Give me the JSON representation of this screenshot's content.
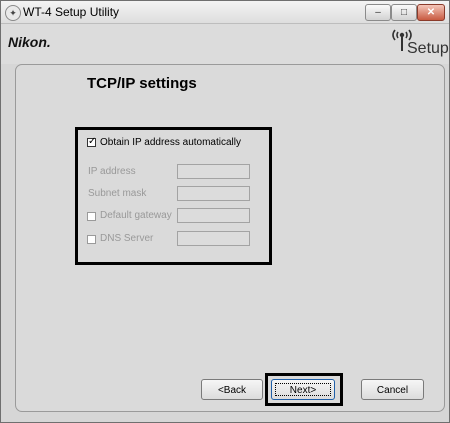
{
  "window": {
    "title": "WT-4 Setup Utility",
    "controls": {
      "minimize": "–",
      "maximize": "□",
      "close": "✕"
    }
  },
  "header": {
    "brand": "Nikon.",
    "setup_logo_text": "Setup",
    "setup_icon": "wireless-antenna-icon"
  },
  "content": {
    "heading": "TCP/IP settings",
    "obtain_auto": {
      "label": "Obtain IP address automatically",
      "checked": true
    },
    "fields": [
      {
        "label": "IP address",
        "value": "",
        "has_checkbox": false
      },
      {
        "label": "Subnet mask",
        "value": "",
        "has_checkbox": false
      },
      {
        "label": "Default gateway",
        "value": "",
        "has_checkbox": true,
        "checked": false
      },
      {
        "label": "DNS Server",
        "value": "",
        "has_checkbox": true,
        "checked": false
      }
    ]
  },
  "buttons": {
    "back": "<Back",
    "next": "Next>",
    "cancel": "Cancel"
  }
}
